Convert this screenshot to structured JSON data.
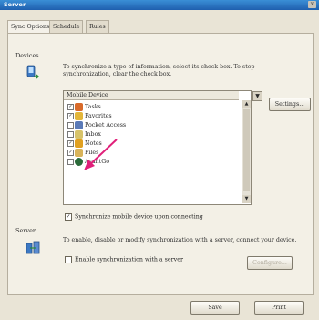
{
  "window": {
    "title": "Server",
    "close_glyph": "x"
  },
  "tabs": [
    {
      "label": "Sync Options"
    },
    {
      "label": "Schedule"
    },
    {
      "label": "Rules"
    }
  ],
  "devices": {
    "title": "Devices",
    "description": "To synchronize a type of information, select its check box. To stop synchronization, clear the check box.",
    "list_header": "Mobile Device",
    "items": [
      {
        "label": "Tasks",
        "checked": true,
        "icon_color": "#d86a2a"
      },
      {
        "label": "Favorites",
        "checked": true,
        "icon_color": "#e3b63a"
      },
      {
        "label": "Pocket Access",
        "checked": false,
        "icon_color": "#5a7ab8"
      },
      {
        "label": "Inbox",
        "checked": false,
        "icon_color": "#d7c36a"
      },
      {
        "label": "Notes",
        "checked": true,
        "icon_color": "#e0a020"
      },
      {
        "label": "Files",
        "checked": true,
        "icon_color": "#d9b45a"
      },
      {
        "label": "AvantGo",
        "checked": false,
        "icon_color": "#2a6a3a"
      }
    ],
    "settings_label": "Settings...",
    "sync_on_connect_label": "Synchronize mobile device upon connecting",
    "sync_on_connect_checked": true
  },
  "server": {
    "title": "Server",
    "description": "To enable, disable or modify synchronization with a server, connect your device.",
    "enable_label": "Enable synchronization with a server",
    "enable_checked": false,
    "configure_label": "Configure..."
  },
  "footer": {
    "ok_label": "Save",
    "cancel_label": "Print"
  },
  "colors": {
    "accent": "#1f5fae",
    "annotation_arrow": "#e0207a"
  }
}
